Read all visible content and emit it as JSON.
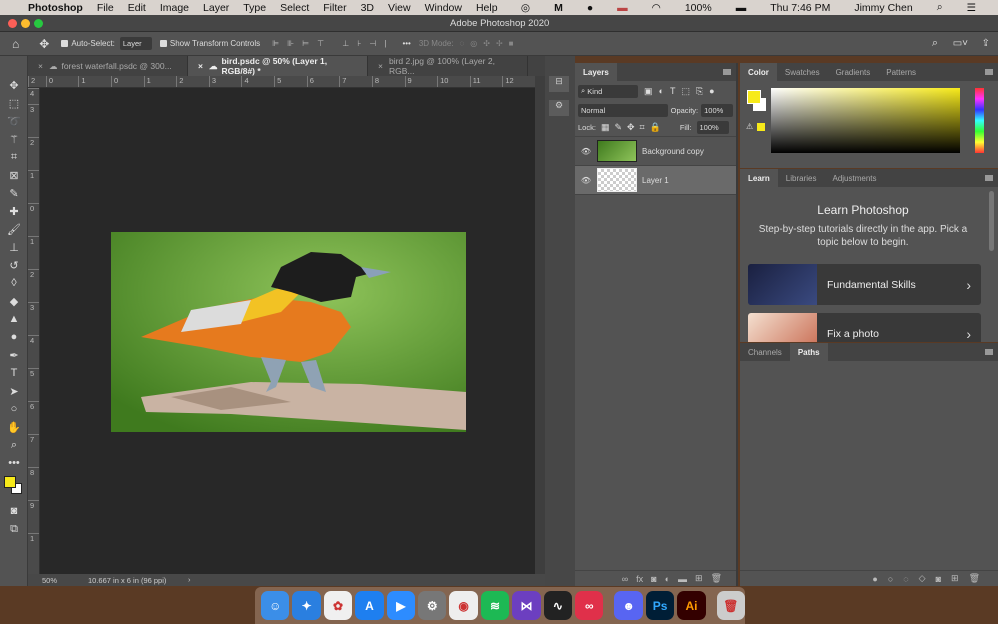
{
  "menubar": {
    "app": "Photoshop",
    "items": [
      "File",
      "Edit",
      "Image",
      "Layer",
      "Type",
      "Select",
      "Filter",
      "3D",
      "View",
      "Window",
      "Help"
    ],
    "battery": "100%",
    "clock": "Thu 7:46 PM",
    "user": "Jimmy Chen"
  },
  "window": {
    "title": "Adobe Photoshop 2020"
  },
  "options": {
    "auto_select_label": "Auto-Select:",
    "auto_select_value": "Layer",
    "transform_label": "Show Transform Controls",
    "mode3d": "3D Mode:"
  },
  "tabs": [
    {
      "label": "forest waterfall.psdc @ 300..."
    },
    {
      "label": "bird.psdc @ 50% (Layer 1, RGB/8#) *"
    },
    {
      "label": "bird 2.jpg @ 100% (Layer 2, RGB..."
    }
  ],
  "ruler_top": [
    "2",
    "0",
    "1",
    "0",
    "1",
    "2",
    "3",
    "4",
    "5",
    "6",
    "7",
    "8",
    "9",
    "10",
    "11",
    "12"
  ],
  "ruler_left": [
    "4",
    "3",
    "2",
    "1",
    "0",
    "1",
    "2",
    "3",
    "4",
    "5",
    "6",
    "7",
    "8",
    "9",
    "1"
  ],
  "status": {
    "zoom": "50%",
    "doc": "10.667 in x 6 in (96 ppi)"
  },
  "layers": {
    "tab": "Layers",
    "filter": "Kind",
    "blend": "Normal",
    "opacity_label": "Opacity:",
    "opacity": "100%",
    "lock_label": "Lock:",
    "fill_label": "Fill:",
    "fill": "100%",
    "items": [
      {
        "name": "Background copy",
        "visible": true
      },
      {
        "name": "Layer 1",
        "visible": true,
        "selected": true
      }
    ]
  },
  "color": {
    "tabs": [
      "Color",
      "Swatches",
      "Gradients",
      "Patterns"
    ],
    "foreground": "#f7ea1a",
    "background": "#ffffff"
  },
  "learn": {
    "tabs": [
      "Learn",
      "Libraries",
      "Adjustments"
    ],
    "title": "Learn Photoshop",
    "desc": "Step-by-step tutorials directly in the app. Pick a topic below to begin.",
    "items": [
      "Fundamental Skills",
      "Fix a photo"
    ]
  },
  "paths": {
    "tabs": [
      "Channels",
      "Paths"
    ]
  },
  "dock": {
    "apps": [
      "Finder",
      "Safari",
      "Photos",
      "App Store",
      "Zoom",
      "System Preferences",
      "Chrome",
      "Spotify",
      "Visual Studio",
      "Activity Monitor",
      "Creative Cloud",
      "Discord",
      "Ps",
      "Ai",
      "Trash"
    ]
  }
}
